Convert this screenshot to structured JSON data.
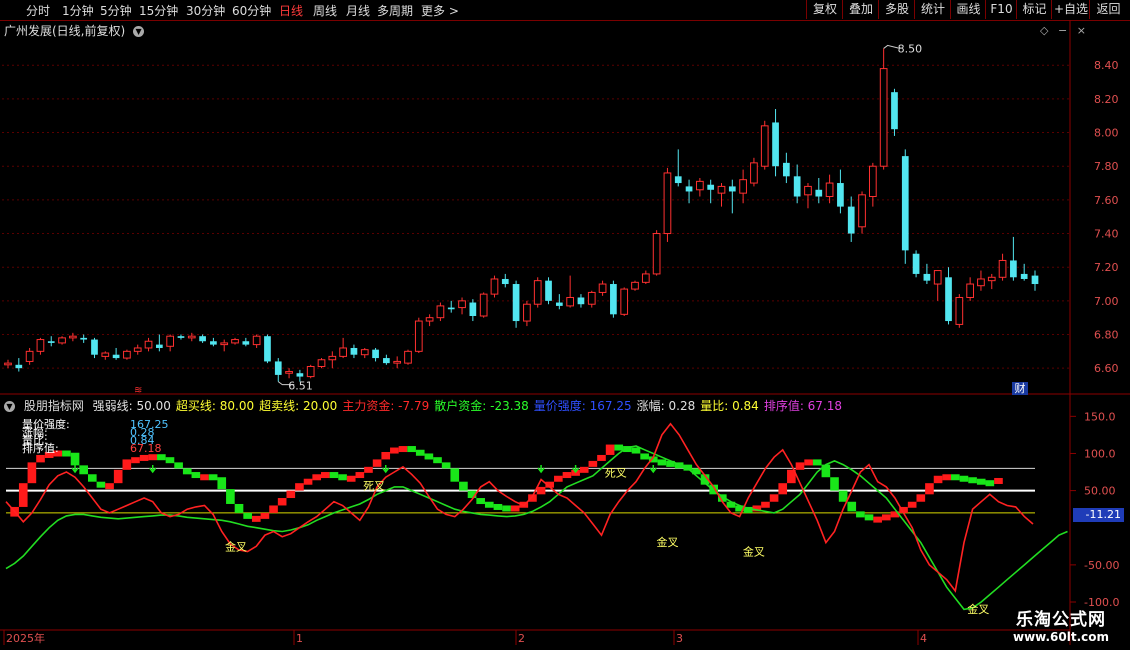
{
  "toolbar": {
    "periods": [
      "分时",
      "1分钟",
      "5分钟",
      "15分钟",
      "30分钟",
      "60分钟",
      "日线",
      "周线",
      "月线",
      "多周期",
      "更多 >"
    ],
    "active_period": "日线",
    "buttons": [
      "复权",
      "叠加",
      "多股",
      "统计",
      "画线",
      "F10",
      "标记",
      "+自选",
      "返回"
    ]
  },
  "stock_title": "广州发展(日线,前复权)",
  "main_chart": {
    "price_ticks": [
      "8.40",
      "8.20",
      "8.00",
      "7.80",
      "7.60",
      "7.40",
      "7.20",
      "7.00",
      "6.80",
      "6.60"
    ],
    "high_label": "8.50",
    "low_label": "6.51",
    "cai_label": "财"
  },
  "indicator": {
    "name": "股朋指标网",
    "items": [
      {
        "label": "强弱线: 50.00",
        "color": "#e0e0e0"
      },
      {
        "label": "超买线: 80.00",
        "color": "#ffff33"
      },
      {
        "label": "超卖线: 20.00",
        "color": "#ffff33"
      },
      {
        "label": "主力资金: -7.79",
        "color": "#ff2a2a"
      },
      {
        "label": "散户资金: -23.38",
        "color": "#2aff2a"
      },
      {
        "label": "量价强度: 167.25",
        "color": "#2f4fff"
      },
      {
        "label": "涨幅: 0.28",
        "color": "#e0e0e0"
      },
      {
        "label": "量比: 0.84",
        "color": "#ffff33"
      },
      {
        "label": "排序值: 67.18",
        "color": "#e040e0"
      }
    ],
    "info_lines": [
      {
        "label": "量价强度:",
        "value": "167.25",
        "color": "#4fc3ff"
      },
      {
        "label": "涨幅:",
        "value": "0.28",
        "color": "#4fc3ff"
      },
      {
        "label": "量比:",
        "value": "0.84",
        "color": "#4fc3ff"
      },
      {
        "label": "排序值:",
        "value": "67.18",
        "color": "#ff4040"
      }
    ],
    "ticks": [
      "150.0",
      "100.0",
      "50.00",
      "-50.00",
      "-100.0"
    ],
    "current_value": "-11.21",
    "annotations": {
      "gold": "金叉",
      "dead": "死叉"
    }
  },
  "date_axis": [
    "2025年",
    "1",
    "2",
    "3",
    "4"
  ],
  "watermark": {
    "line1": "乐淘公式网",
    "line2": "www.60lt.com"
  },
  "chart_data": [
    {
      "type": "candlestick",
      "title": "广州发展(日线,前复权)",
      "ylim": [
        6.5,
        8.55
      ],
      "candles": [
        [
          6.62,
          6.65,
          6.6,
          6.63
        ],
        [
          6.62,
          6.66,
          6.58,
          6.6
        ],
        [
          6.64,
          6.72,
          6.62,
          6.7
        ],
        [
          6.7,
          6.78,
          6.68,
          6.77
        ],
        [
          6.76,
          6.79,
          6.73,
          6.75
        ],
        [
          6.75,
          6.79,
          6.74,
          6.78
        ],
        [
          6.78,
          6.81,
          6.76,
          6.79
        ],
        [
          6.78,
          6.8,
          6.75,
          6.77
        ],
        [
          6.77,
          6.78,
          6.66,
          6.68
        ],
        [
          6.67,
          6.7,
          6.65,
          6.69
        ],
        [
          6.68,
          6.72,
          6.65,
          6.66
        ],
        [
          6.66,
          6.71,
          6.65,
          6.7
        ],
        [
          6.7,
          6.74,
          6.68,
          6.72
        ],
        [
          6.72,
          6.78,
          6.7,
          6.76
        ],
        [
          6.74,
          6.8,
          6.7,
          6.72
        ],
        [
          6.73,
          6.8,
          6.7,
          6.79
        ],
        [
          6.79,
          6.8,
          6.77,
          6.78
        ],
        [
          6.78,
          6.81,
          6.76,
          6.79
        ],
        [
          6.79,
          6.8,
          6.75,
          6.76
        ],
        [
          6.76,
          6.78,
          6.73,
          6.74
        ],
        [
          6.74,
          6.77,
          6.7,
          6.75
        ],
        [
          6.75,
          6.78,
          6.74,
          6.77
        ],
        [
          6.76,
          6.78,
          6.73,
          6.74
        ],
        [
          6.74,
          6.8,
          6.72,
          6.79
        ],
        [
          6.79,
          6.8,
          6.63,
          6.64
        ],
        [
          6.64,
          6.66,
          6.52,
          6.56
        ],
        [
          6.57,
          6.6,
          6.54,
          6.58
        ],
        [
          6.57,
          6.59,
          6.52,
          6.55
        ],
        [
          6.55,
          6.62,
          6.54,
          6.61
        ],
        [
          6.61,
          6.66,
          6.6,
          6.65
        ],
        [
          6.65,
          6.7,
          6.6,
          6.67
        ],
        [
          6.67,
          6.78,
          6.66,
          6.72
        ],
        [
          6.72,
          6.74,
          6.66,
          6.68
        ],
        [
          6.68,
          6.72,
          6.66,
          6.71
        ],
        [
          6.71,
          6.72,
          6.64,
          6.66
        ],
        [
          6.66,
          6.68,
          6.62,
          6.63
        ],
        [
          6.63,
          6.67,
          6.6,
          6.64
        ],
        [
          6.63,
          6.71,
          6.62,
          6.7
        ],
        [
          6.7,
          6.9,
          6.69,
          6.88
        ],
        [
          6.88,
          6.92,
          6.85,
          6.9
        ],
        [
          6.9,
          6.99,
          6.88,
          6.97
        ],
        [
          6.96,
          7.0,
          6.93,
          6.95
        ],
        [
          6.96,
          7.02,
          6.92,
          7.0
        ],
        [
          6.99,
          7.01,
          6.88,
          6.91
        ],
        [
          6.91,
          7.05,
          6.9,
          7.04
        ],
        [
          7.04,
          7.15,
          7.02,
          7.13
        ],
        [
          7.13,
          7.16,
          7.08,
          7.1
        ],
        [
          7.1,
          7.12,
          6.84,
          6.88
        ],
        [
          6.88,
          7.0,
          6.85,
          6.98
        ],
        [
          6.98,
          7.14,
          6.96,
          7.12
        ],
        [
          7.12,
          7.14,
          6.98,
          7.0
        ],
        [
          6.99,
          7.04,
          6.95,
          6.97
        ],
        [
          6.97,
          7.15,
          6.96,
          7.02
        ],
        [
          7.02,
          7.04,
          6.96,
          6.98
        ],
        [
          6.98,
          7.06,
          6.96,
          7.05
        ],
        [
          7.05,
          7.12,
          7.03,
          7.1
        ],
        [
          7.1,
          7.12,
          6.9,
          6.92
        ],
        [
          6.92,
          7.08,
          6.91,
          7.07
        ],
        [
          7.07,
          7.12,
          7.06,
          7.11
        ],
        [
          7.11,
          7.18,
          7.1,
          7.16
        ],
        [
          7.16,
          7.42,
          7.15,
          7.4
        ],
        [
          7.4,
          7.79,
          7.35,
          7.76
        ],
        [
          7.74,
          7.9,
          7.68,
          7.7
        ],
        [
          7.68,
          7.72,
          7.58,
          7.65
        ],
        [
          7.66,
          7.73,
          7.62,
          7.71
        ],
        [
          7.69,
          7.72,
          7.58,
          7.66
        ],
        [
          7.64,
          7.7,
          7.56,
          7.68
        ],
        [
          7.68,
          7.72,
          7.52,
          7.65
        ],
        [
          7.64,
          7.78,
          7.58,
          7.72
        ],
        [
          7.7,
          7.85,
          7.68,
          7.82
        ],
        [
          7.8,
          8.07,
          7.78,
          8.04
        ],
        [
          8.06,
          8.14,
          7.74,
          7.8
        ],
        [
          7.82,
          7.88,
          7.7,
          7.74
        ],
        [
          7.74,
          7.81,
          7.58,
          7.62
        ],
        [
          7.63,
          7.7,
          7.55,
          7.68
        ],
        [
          7.66,
          7.73,
          7.58,
          7.62
        ],
        [
          7.62,
          7.75,
          7.58,
          7.7
        ],
        [
          7.7,
          7.78,
          7.52,
          7.56
        ],
        [
          7.56,
          7.62,
          7.35,
          7.4
        ],
        [
          7.44,
          7.65,
          7.4,
          7.63
        ],
        [
          7.62,
          7.82,
          7.56,
          7.8
        ],
        [
          7.8,
          8.5,
          7.78,
          8.38
        ],
        [
          8.24,
          8.26,
          7.98,
          8.02
        ],
        [
          7.86,
          7.9,
          7.22,
          7.3
        ],
        [
          7.28,
          7.3,
          7.14,
          7.16
        ],
        [
          7.16,
          7.22,
          7.1,
          7.12
        ],
        [
          7.1,
          7.18,
          7.0,
          7.18
        ],
        [
          7.14,
          7.2,
          6.86,
          6.88
        ],
        [
          6.86,
          7.04,
          6.84,
          7.02
        ],
        [
          7.02,
          7.14,
          7.0,
          7.1
        ],
        [
          7.09,
          7.18,
          7.06,
          7.13
        ],
        [
          7.12,
          7.16,
          7.07,
          7.14
        ],
        [
          7.14,
          7.28,
          7.12,
          7.24
        ],
        [
          7.24,
          7.38,
          7.12,
          7.14
        ],
        [
          7.16,
          7.22,
          7.12,
          7.13
        ],
        [
          7.15,
          7.18,
          7.06,
          7.1
        ]
      ]
    },
    {
      "type": "line",
      "title": "股朋指标网",
      "ylim": [
        -135,
        172
      ],
      "reference_lines": [
        {
          "name": "强弱线",
          "value": 50
        },
        {
          "name": "超买线",
          "value": 80
        },
        {
          "name": "超卖线",
          "value": 20
        }
      ],
      "series": [
        {
          "name": "主力资金",
          "color": "#ff2a2a",
          "values": [
            35,
            22,
            8,
            20,
            38,
            58,
            70,
            75,
            68,
            55,
            40,
            25,
            20,
            25,
            30,
            35,
            40,
            35,
            20,
            15,
            18,
            25,
            28,
            30,
            18,
            -5,
            -22,
            -30,
            -32,
            -25,
            -10,
            -5,
            -12,
            -8,
            0,
            8,
            15,
            25,
            35,
            30,
            20,
            10,
            28,
            55,
            68,
            75,
            82,
            72,
            60,
            42,
            25,
            18,
            15,
            25,
            38,
            55,
            62,
            50,
            42,
            35,
            30,
            42,
            65,
            55,
            45,
            40,
            30,
            20,
            5,
            -10,
            18,
            35,
            50,
            62,
            80,
            95,
            125,
            140,
            125,
            105,
            85,
            70,
            55,
            35,
            20,
            15,
            40,
            60,
            80,
            95,
            105,
            85,
            60,
            35,
            10,
            -20,
            -5,
            25,
            50,
            75,
            85,
            62,
            55,
            40,
            20,
            0,
            -30,
            -50,
            -60,
            -70,
            -85,
            -20,
            25,
            35,
            45,
            35,
            30,
            28,
            15,
            5
          ]
        },
        {
          "name": "散户资金",
          "color": "#2aff2a",
          "values": [
            -55,
            -48,
            -38,
            -25,
            -12,
            0,
            10,
            16,
            18,
            18,
            16,
            14,
            13,
            12,
            13,
            14,
            15,
            16,
            17,
            17,
            16,
            14,
            13,
            12,
            11,
            10,
            8,
            5,
            2,
            0,
            -2,
            -4,
            -5,
            -3,
            0,
            4,
            10,
            15,
            20,
            24,
            28,
            32,
            38,
            45,
            50,
            55,
            55,
            50,
            45,
            40,
            35,
            30,
            25,
            22,
            20,
            18,
            17,
            16,
            15,
            16,
            18,
            22,
            28,
            35,
            45,
            55,
            60,
            65,
            70,
            80,
            90,
            100,
            108,
            110,
            105,
            100,
            95,
            90,
            85,
            80,
            70,
            60,
            50,
            42,
            35,
            30,
            26,
            24,
            22,
            20,
            25,
            35,
            45,
            60,
            75,
            85,
            90,
            85,
            78,
            70,
            60,
            50,
            40,
            25,
            10,
            -5,
            -20,
            -40,
            -60,
            -80,
            -95,
            -110,
            -108,
            -100,
            -90,
            -80,
            -70,
            -60,
            -50,
            -40,
            -30,
            -20,
            -10,
            -5
          ]
        },
        {
          "name": "强弱线阶梯",
          "color": "red/green",
          "values": [
            15,
            28,
            60,
            88,
            98,
            102,
            104,
            101,
            84,
            72,
            62,
            55,
            60,
            78,
            92,
            95,
            98,
            99,
            95,
            88,
            80,
            75,
            70,
            72,
            68,
            52,
            32,
            20,
            14,
            16,
            20,
            30,
            40,
            50,
            60,
            66,
            72,
            75,
            72,
            70,
            70,
            75,
            82,
            92,
            102,
            108,
            110,
            105,
            100,
            95,
            88,
            80,
            62,
            50,
            40,
            35,
            32,
            30,
            28,
            30,
            35,
            45,
            55,
            62,
            70,
            75,
            78,
            82,
            90,
            98,
            112,
            110,
            108,
            100,
            96,
            92,
            90,
            88,
            85,
            80,
            72,
            58,
            45,
            35,
            30,
            28,
            25,
            30,
            35,
            45,
            60,
            78,
            88,
            92,
            85,
            68,
            50,
            35,
            22,
            18,
            15,
            15,
            18,
            22,
            28,
            35,
            45,
            60,
            70,
            72,
            70,
            68,
            66,
            64,
            62,
            67
          ]
        }
      ]
    }
  ]
}
